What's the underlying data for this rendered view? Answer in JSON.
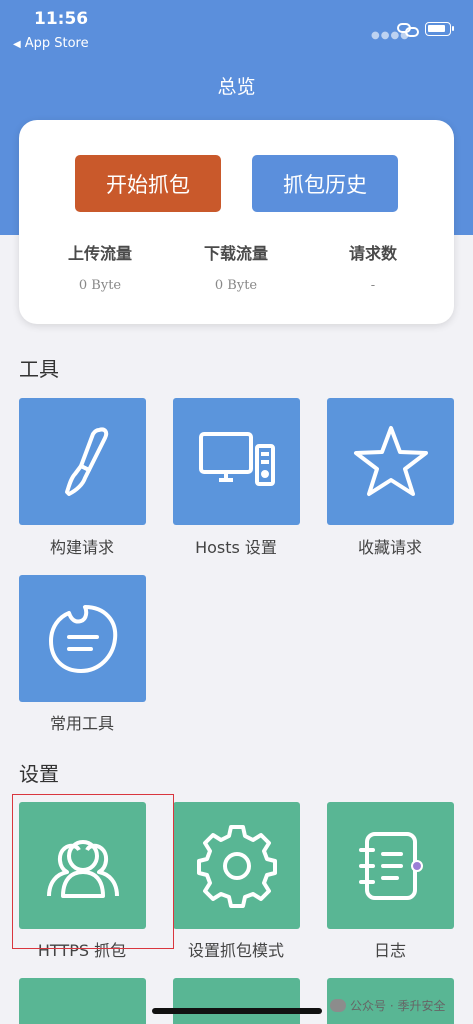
{
  "status_bar": {
    "time": "11:56",
    "back_app": "App Store",
    "back_arrow": "◀"
  },
  "nav": {
    "title": "总览"
  },
  "summary": {
    "start_button": "开始抓包",
    "history_button": "抓包历史",
    "stats": [
      {
        "label": "上传流量",
        "value": "0 Byte"
      },
      {
        "label": "下载流量",
        "value": "0 Byte"
      },
      {
        "label": "请求数",
        "value": "-"
      }
    ]
  },
  "tools": {
    "title": "工具",
    "items": [
      {
        "label": "构建请求",
        "icon": "brush-icon"
      },
      {
        "label": "Hosts 设置",
        "icon": "computer-icon"
      },
      {
        "label": "收藏请求",
        "icon": "star-icon"
      },
      {
        "label": "常用工具",
        "icon": "tool-bubble-icon"
      }
    ]
  },
  "settings": {
    "title": "设置",
    "items": [
      {
        "label": "HTTPS 抓包",
        "icon": "users-icon"
      },
      {
        "label": "设置抓包模式",
        "icon": "gear-icon"
      },
      {
        "label": "日志",
        "icon": "notebook-icon"
      }
    ]
  },
  "watermark": {
    "text": "公众号 · 季升安全"
  },
  "colors": {
    "header": "#5b8fdc",
    "start_button": "#c9592b",
    "tool_tile": "#5b95dc",
    "setting_tile": "#59b694",
    "highlight": "#d9363e"
  }
}
